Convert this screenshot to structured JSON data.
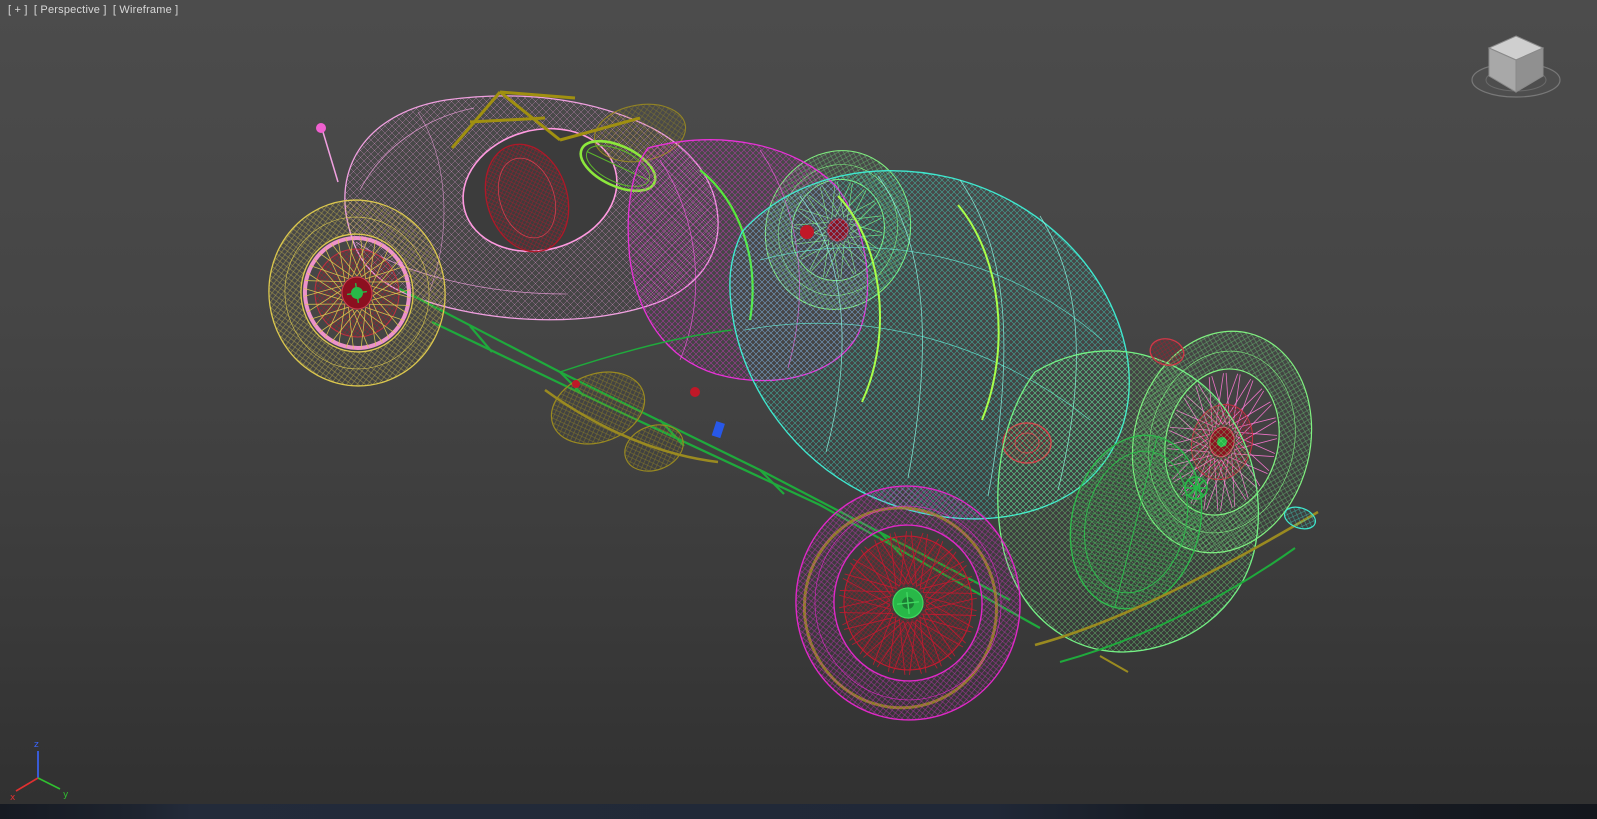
{
  "viewport": {
    "label": {
      "general_menu": "[ + ]",
      "pov_menu": "[ Perspective ]",
      "shading_menu": "[ Wireframe ]"
    }
  },
  "axis_tripod": {
    "x_label": "x",
    "y_label": "y",
    "z_label": "z"
  },
  "scene": {
    "object": "vintage race car wireframe model",
    "view": "Perspective",
    "shading": "Wireframe"
  },
  "colors": {
    "background_top": "#4c4c4c",
    "background_bottom": "#303030",
    "label_text": "#d8d8d8",
    "tail_body_pink": "#f0a0e0",
    "mid_body_magenta": "#e832d8",
    "hood_cyan": "#3fe8cf",
    "cowl_green": "#74f084",
    "chassis_green": "#1faa3c",
    "wheel_rear_left": "#dcc84e",
    "wheel_front_left": "#e028c8",
    "wheel_front_right": "#80f080",
    "wheel_rear_right": "#80f080",
    "spoke_dark_red": "#c41a30",
    "spoke_pink": "#ff7ad6",
    "hub_dark_red": "#8c1020",
    "hub_green": "#28b848",
    "olive": "#9a8a20",
    "steering_green": "#8ce83c",
    "rim_pink": "#ff9ad8",
    "axis_x_red": "#e03030",
    "axis_y_green": "#30c030",
    "axis_z_blue": "#3b66ff"
  }
}
